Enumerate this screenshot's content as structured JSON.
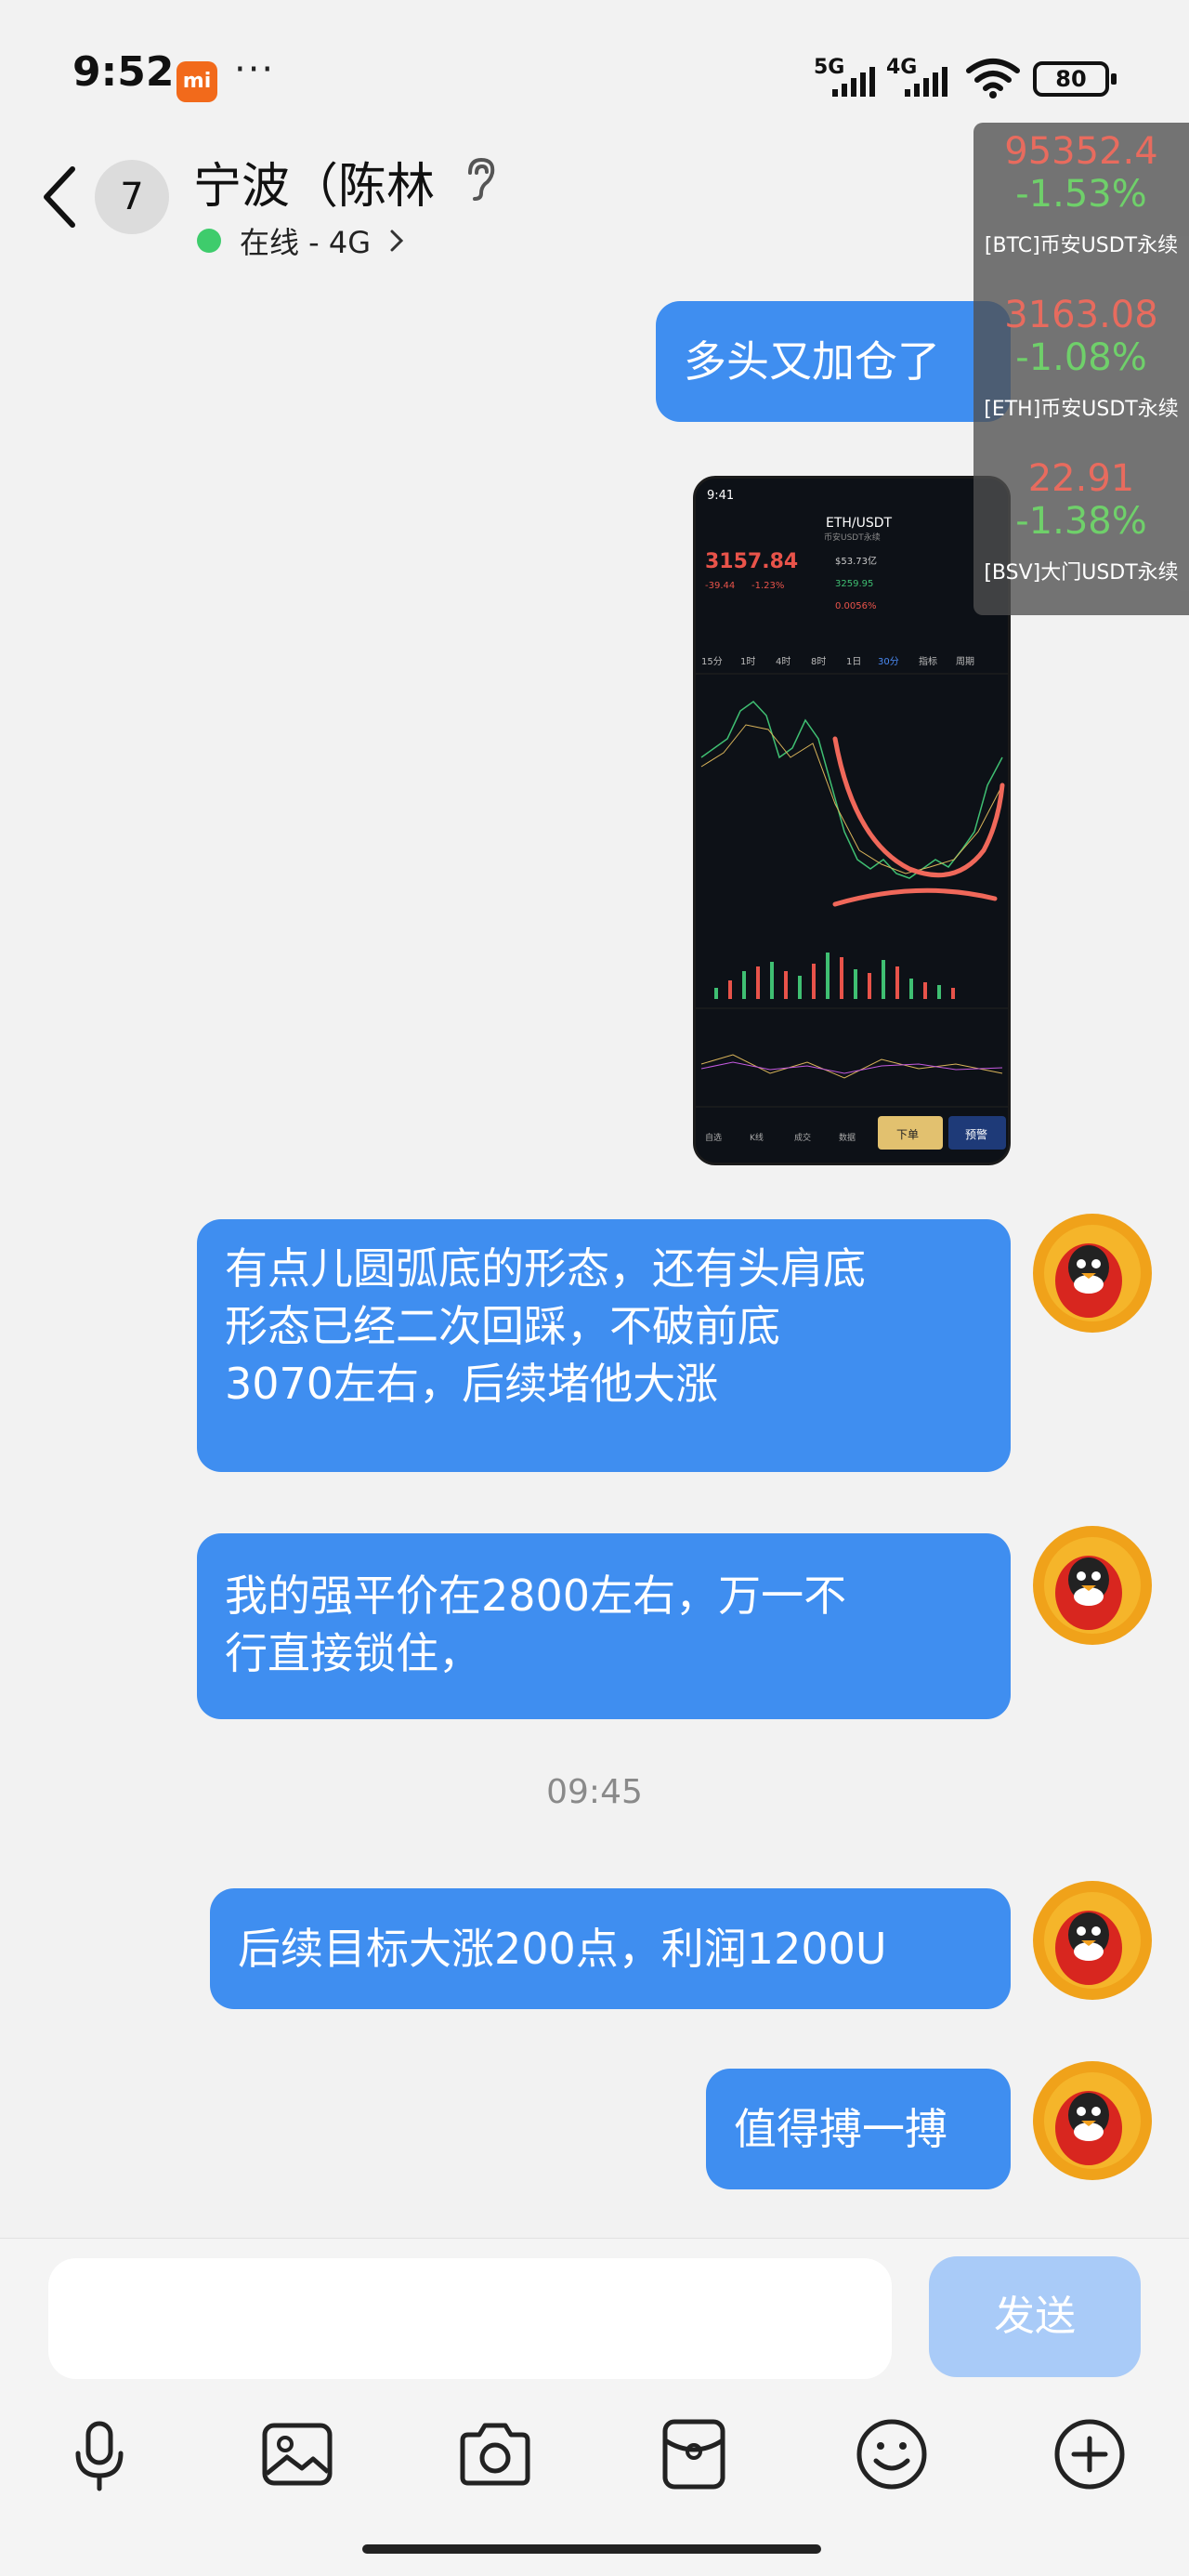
{
  "status_bar": {
    "time": "9:52",
    "mi_label": "mi",
    "more": "···",
    "signal1_label": "5G",
    "signal2_label": "4G",
    "battery": "80"
  },
  "header": {
    "unread_count": "7",
    "title": "宁波（陈林",
    "online_status": "在线 - 4G"
  },
  "ticker": [
    {
      "price": "95352.4",
      "change": "-1.53%",
      "label": "[BTC]币安USDT永续"
    },
    {
      "price": "3163.08",
      "change": "-1.08%",
      "label": "[ETH]币安USDT永续"
    },
    {
      "price": "22.91",
      "change": "-1.38%",
      "label": "[BSV]大门USDT永续"
    }
  ],
  "messages": {
    "m1": "多头又加仓了",
    "m2_l1": "有点儿圆弧底的形态，还有头肩底",
    "m2_l2": "形态已经二次回踩，不破前底",
    "m2_l3": "3070左右，后续堵他大涨",
    "m3_l1": "我的强平价在2800左右，万一不",
    "m3_l2": "行直接锁住，",
    "timestamp": "09:45",
    "m4": "后续目标大涨200点，利润1200U",
    "m5": "值得搏一搏"
  },
  "shared_image": {
    "time": "9:41",
    "pair": "ETH/USDT",
    "pair_sub": "币安USDT永续",
    "price": "3157.84",
    "change": "-39.44",
    "change_pct": "-1.23%",
    "volume": "$53.73亿",
    "high": "3259.95",
    "funding": "0.0056%",
    "tabs": [
      "15分",
      "1时",
      "4时",
      "8时",
      "1日",
      "30分",
      "指标",
      "周期"
    ],
    "bottom_nav": [
      "自选",
      "K线",
      "成交",
      "数据"
    ],
    "order_button": "下单",
    "alert_button": "预警"
  },
  "input": {
    "placeholder": "",
    "send_label": "发送"
  },
  "colors": {
    "bubble": "#3f8ef0",
    "send_disabled": "#a9cbf8",
    "online": "#3ecc6c",
    "ticker_price": "#e86b5e",
    "ticker_change": "#6fd06a"
  },
  "icons": [
    "back-icon",
    "ear-icon",
    "chevron-right-icon",
    "microphone-icon",
    "image-icon",
    "camera-icon",
    "red-packet-icon",
    "emoji-icon",
    "plus-icon"
  ]
}
